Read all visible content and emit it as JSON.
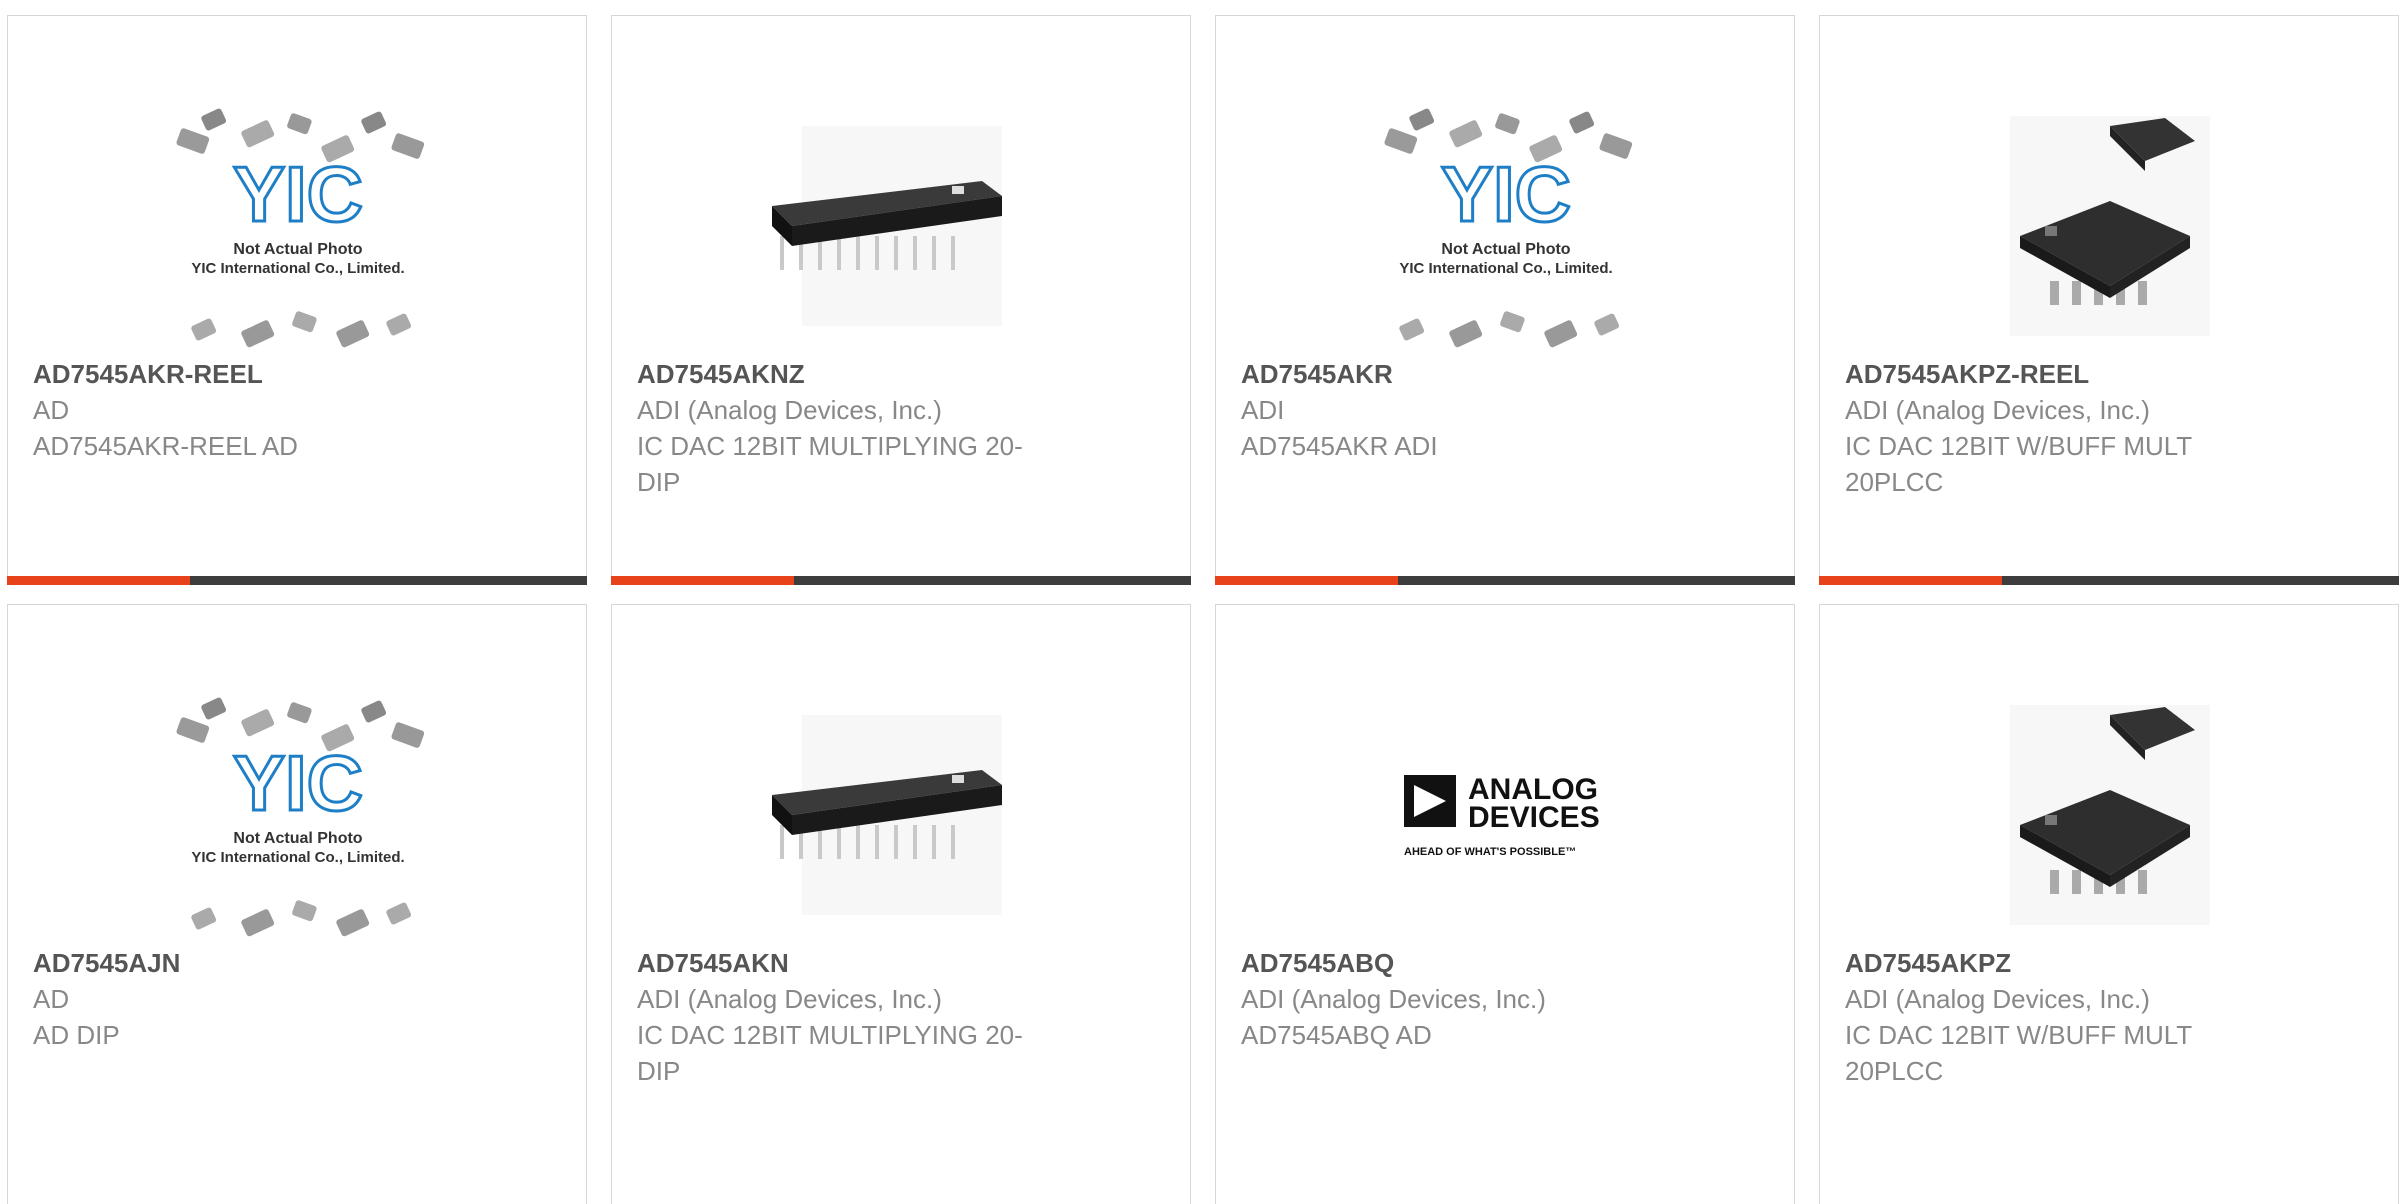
{
  "products": [
    {
      "part": "AD7545AKR-REEL",
      "manufacturer": "AD",
      "description": "AD7545AKR-REEL AD",
      "image": "placeholder"
    },
    {
      "part": "AD7545AKNZ",
      "manufacturer": "ADI (Analog Devices, Inc.)",
      "description": "IC DAC 12BIT MULTIPLYING 20-DIP",
      "image": "dip"
    },
    {
      "part": "AD7545AKR",
      "manufacturer": "ADI",
      "description": "AD7545AKR ADI",
      "image": "placeholder"
    },
    {
      "part": "AD7545AKPZ-REEL",
      "manufacturer": "ADI (Analog Devices, Inc.)",
      "description": "IC DAC 12BIT W/BUFF MULT 20PLCC",
      "image": "plcc"
    },
    {
      "part": "AD7545AJN",
      "manufacturer": "AD",
      "description": "AD DIP",
      "image": "placeholder"
    },
    {
      "part": "AD7545AKN",
      "manufacturer": "ADI (Analog Devices, Inc.)",
      "description": "IC DAC 12BIT MULTIPLYING 20-DIP",
      "image": "dip"
    },
    {
      "part": "AD7545ABQ",
      "manufacturer": "ADI (Analog Devices, Inc.)",
      "description": "AD7545ABQ AD",
      "image": "logo"
    },
    {
      "part": "AD7545AKPZ",
      "manufacturer": "ADI (Analog Devices, Inc.)",
      "description": "IC DAC 12BIT W/BUFF MULT 20PLCC",
      "image": "plcc"
    }
  ],
  "placeholder_image": {
    "brand": "YIC",
    "line1": "Not Actual Photo",
    "line2": "YIC International Co., Limited."
  },
  "logo_image": {
    "line1": "ANALOG",
    "line2": "DEVICES",
    "tagline": "AHEAD OF WHAT'S POSSIBLE™"
  },
  "colors": {
    "accent": "#e8421a",
    "bar": "#3d3d3d",
    "title": "#555555",
    "text": "#888888",
    "yic_blue": "#1e7fc6"
  }
}
